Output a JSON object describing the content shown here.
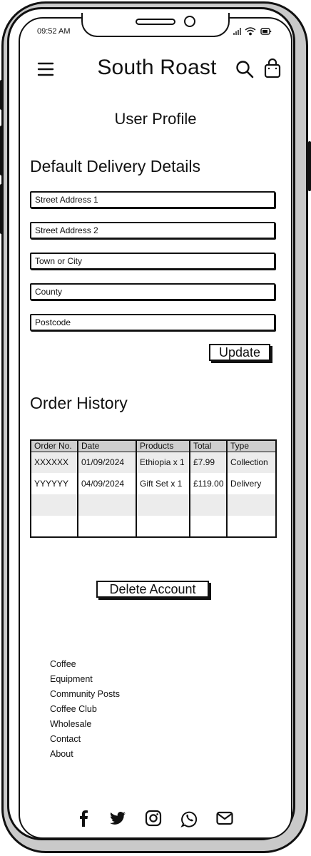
{
  "status_bar": {
    "time": "09:52 AM"
  },
  "header": {
    "brand": "South Roast"
  },
  "page": {
    "title": "User Profile"
  },
  "delivery": {
    "title": "Default Delivery Details",
    "fields": [
      {
        "placeholder": "Street Address 1"
      },
      {
        "placeholder": "Street Address 2"
      },
      {
        "placeholder": "Town or City"
      },
      {
        "placeholder": "County"
      },
      {
        "placeholder": "Postcode"
      }
    ],
    "update_label": "Update"
  },
  "orders": {
    "title": "Order History",
    "columns": [
      "Order No.",
      "Date",
      "Products",
      "Total",
      "Type"
    ],
    "rows": [
      [
        "XXXXXX",
        "01/09/2024",
        "Ethiopia x 1",
        "£7.99",
        "Collection"
      ],
      [
        "YYYYYY",
        "04/09/2024",
        "Gift Set x 1",
        "£119.00",
        "Delivery"
      ]
    ]
  },
  "account": {
    "delete_label": "Delete Account"
  },
  "footer": {
    "links": [
      "Coffee",
      "Equipment",
      "Community Posts",
      "Coffee Club",
      "Wholesale",
      "Contact",
      "About"
    ]
  },
  "social_icons": [
    "facebook-icon",
    "twitter-icon",
    "instagram-icon",
    "whatsapp-icon",
    "mail-icon"
  ]
}
